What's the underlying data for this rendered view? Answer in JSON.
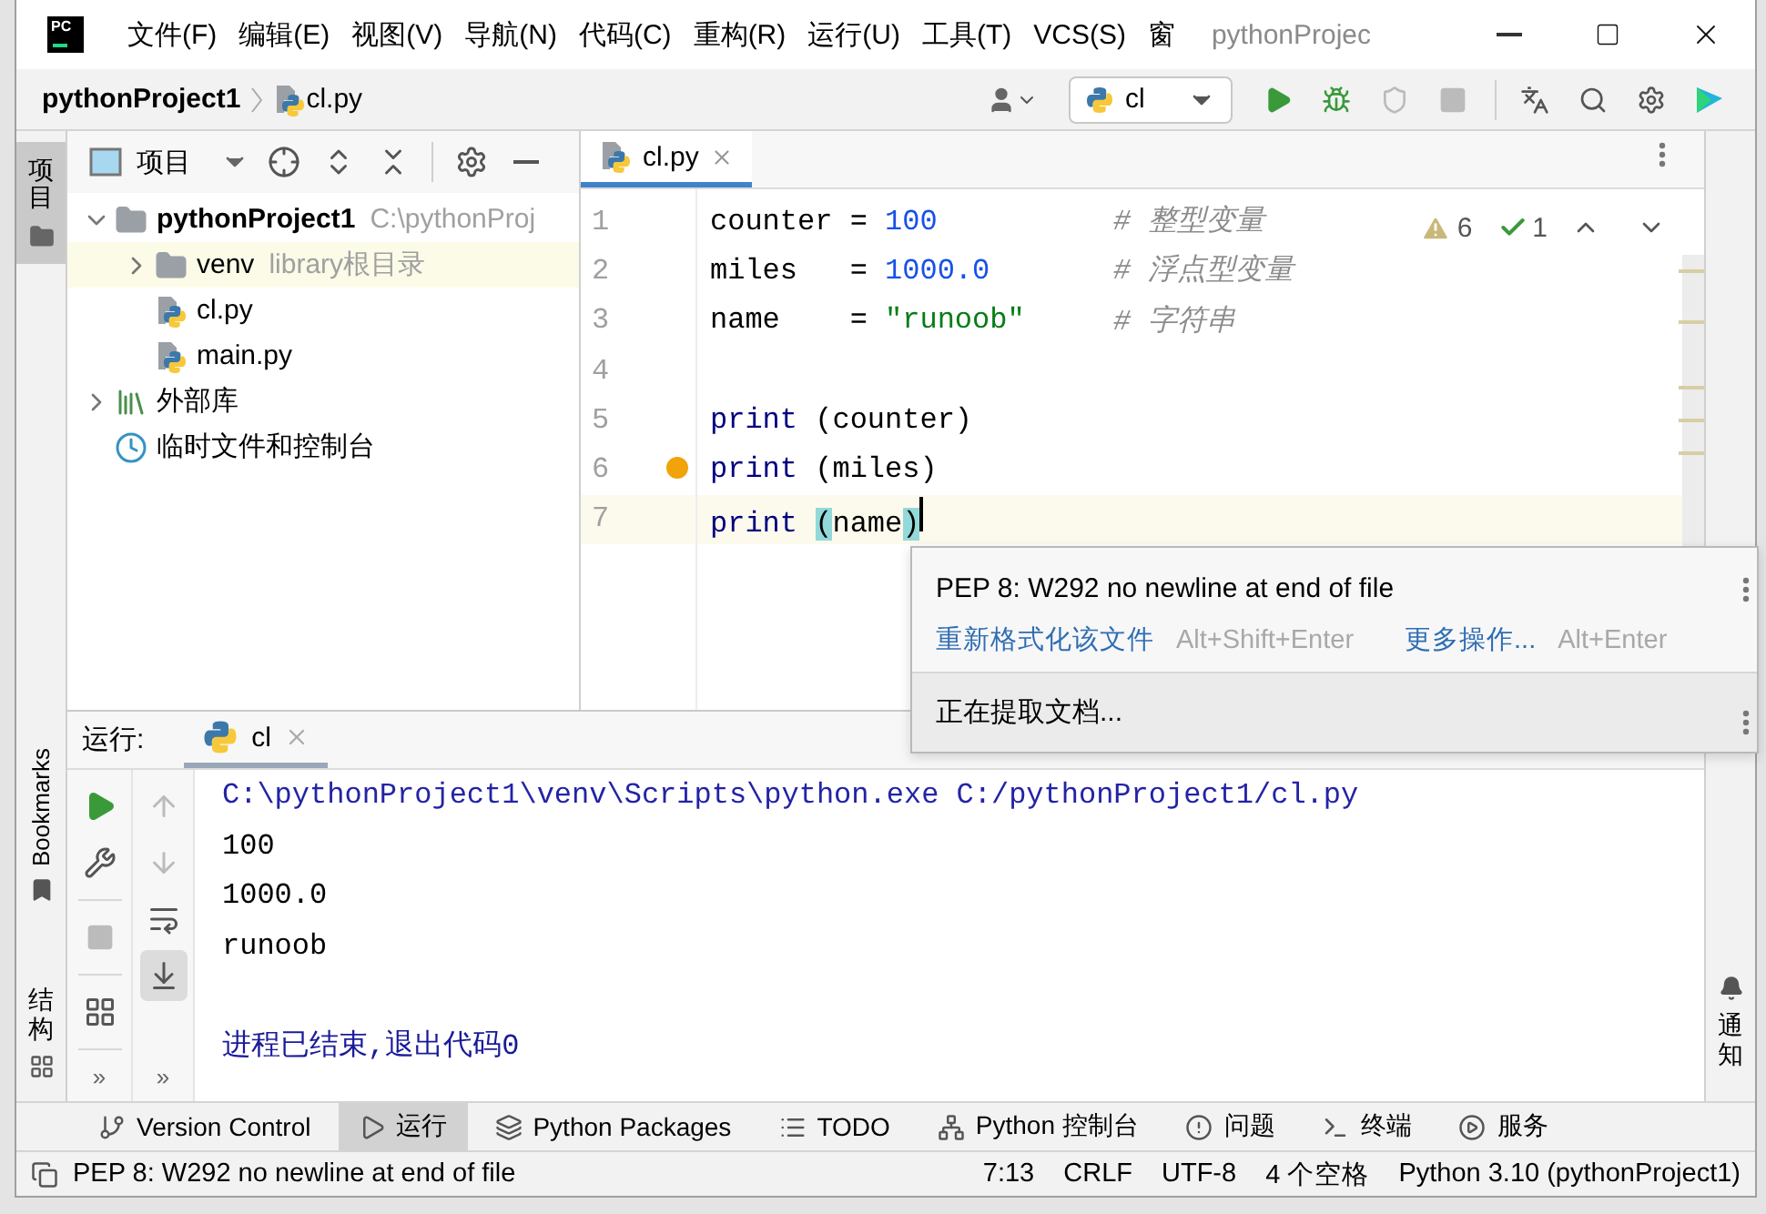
{
  "window": {
    "logo_text": "PC",
    "title": "pythonProjec",
    "menu": [
      "文件(F)",
      "编辑(E)",
      "视图(V)",
      "导航(N)",
      "代码(C)",
      "重构(R)",
      "运行(U)",
      "工具(T)",
      "VCS(S)",
      "窗"
    ]
  },
  "breadcrumb": [
    "pythonProject1",
    "cl.py"
  ],
  "toolbar": [
    {
      "kind": "user"
    },
    {
      "kind": "run-config",
      "label": "cl"
    },
    {
      "kind": "run",
      "disabled": false
    },
    {
      "kind": "debug",
      "disabled": false
    },
    {
      "kind": "coverage",
      "disabled": true
    },
    {
      "kind": "stop",
      "disabled": true
    },
    {
      "kind": "separator"
    },
    {
      "kind": "translate"
    },
    {
      "kind": "search"
    },
    {
      "kind": "settings"
    },
    {
      "kind": "toolbox"
    }
  ],
  "left_stripe": {
    "top": [
      {
        "label": "项目",
        "selected": true
      }
    ],
    "bottom": [
      {
        "label": "Bookmarks",
        "kind": "bookmarks"
      },
      {
        "label": "结构",
        "kind": "structure"
      }
    ]
  },
  "right_stripe": [
    {
      "label": "通知",
      "kind": "notifications"
    }
  ],
  "project_panel": {
    "title": "项目",
    "tree": [
      {
        "label": "pythonProject1",
        "hint": "C:\\pythonProj",
        "kind": "folder",
        "bold": true,
        "expanded": true,
        "children": [
          {
            "label": "venv",
            "hint": "library根目录",
            "kind": "library-root",
            "expanded": false
          },
          {
            "label": "cl.py",
            "kind": "python"
          },
          {
            "label": "main.py",
            "kind": "python"
          }
        ]
      },
      {
        "label": "外部库",
        "kind": "library",
        "expanded": false
      },
      {
        "label": "临时文件和控制台",
        "kind": "scratch"
      }
    ]
  },
  "editor": {
    "tabs": [
      {
        "label": "cl.py",
        "selected": true
      }
    ],
    "inspections": {
      "warnings": "6",
      "weak_warnings": "1"
    },
    "lines": [
      {
        "number": "1",
        "current": false,
        "tokens": [
          {
            "kind": "plain",
            "text": "counter = "
          },
          {
            "kind": "number",
            "text": "100"
          }
        ],
        "comment": "# 整型变量"
      },
      {
        "number": "2",
        "current": false,
        "tokens": [
          {
            "kind": "plain",
            "text": "miles   = "
          },
          {
            "kind": "number",
            "text": "1000.0"
          }
        ],
        "comment": "# 浮点型变量"
      },
      {
        "number": "3",
        "current": false,
        "tokens": [
          {
            "kind": "plain",
            "text": "name    = "
          },
          {
            "kind": "string",
            "text": "\"runoob\""
          }
        ],
        "comment": "# 字符串"
      },
      {
        "number": "4",
        "current": false
      },
      {
        "number": "5",
        "current": false,
        "tokens": [
          {
            "kind": "keyword",
            "text": "print"
          },
          {
            "kind": "plain",
            "text": " (counter)"
          }
        ]
      },
      {
        "number": "6",
        "current": false,
        "bulb": true,
        "tokens": [
          {
            "kind": "keyword",
            "text": "print"
          },
          {
            "kind": "plain",
            "text": " (miles)"
          }
        ]
      },
      {
        "number": "7",
        "current": true,
        "tokens": [
          {
            "kind": "keyword",
            "text": "print "
          },
          {
            "kind": "brace-match",
            "text": "("
          },
          {
            "kind": "plain",
            "text": "name"
          },
          {
            "kind": "brace-match",
            "text": ")"
          }
        ]
      }
    ]
  },
  "popup": {
    "message": "PEP 8: W292 no newline at end of file",
    "actions": [
      {
        "label": "重新格式化该文件",
        "shortcut": "Alt+Shift+Enter"
      },
      {
        "label": "更多操作...",
        "shortcut": "Alt+Enter"
      }
    ],
    "doc_status": "正在提取文档..."
  },
  "run_panel": {
    "title": "运行:",
    "tabs": [
      {
        "label": "cl",
        "selected": true
      }
    ],
    "run_toolbar": [
      {
        "kind": "rerun",
        "disabled": false
      },
      {
        "kind": "settings",
        "disabled": false
      },
      {
        "kind": "stop",
        "disabled": true
      },
      {
        "kind": "layout",
        "disabled": false
      }
    ],
    "console_toolbar": [
      {
        "kind": "up",
        "disabled": true
      },
      {
        "kind": "down",
        "disabled": true
      },
      {
        "kind": "soft-wrap",
        "on": false
      },
      {
        "kind": "scroll-to-end",
        "on": true
      }
    ],
    "more": [
      "»",
      "»"
    ],
    "output": [
      {
        "kind": "command",
        "text": "C:\\pythonProject1\\venv\\Scripts\\python.exe C:/pythonProject1/cl.py"
      },
      {
        "kind": "stdout",
        "text": "100"
      },
      {
        "kind": "stdout",
        "text": "1000.0"
      },
      {
        "kind": "stdout",
        "text": "runoob"
      },
      {
        "kind": "system",
        "text": "进程已结束,退出代码0"
      }
    ]
  },
  "tool_windows": [
    {
      "label": "Version Control",
      "kind": "vcs",
      "selected": false
    },
    {
      "label": "运行",
      "kind": "run",
      "selected": true
    },
    {
      "label": "Python Packages",
      "kind": "packages",
      "selected": false
    },
    {
      "label": "TODO",
      "kind": "todo",
      "selected": false
    },
    {
      "label": "Python 控制台",
      "kind": "console",
      "selected": false
    },
    {
      "label": "问题",
      "kind": "problems",
      "selected": false
    },
    {
      "label": "终端",
      "kind": "terminal",
      "selected": false
    },
    {
      "label": "服务",
      "kind": "services",
      "selected": false
    }
  ],
  "status_bar": {
    "message": "PEP 8: W292 no newline at end of file",
    "items": [
      "7:13",
      "CRLF",
      "UTF-8",
      "4 个空格",
      "Python 3.10 (pythonProject1)"
    ]
  }
}
